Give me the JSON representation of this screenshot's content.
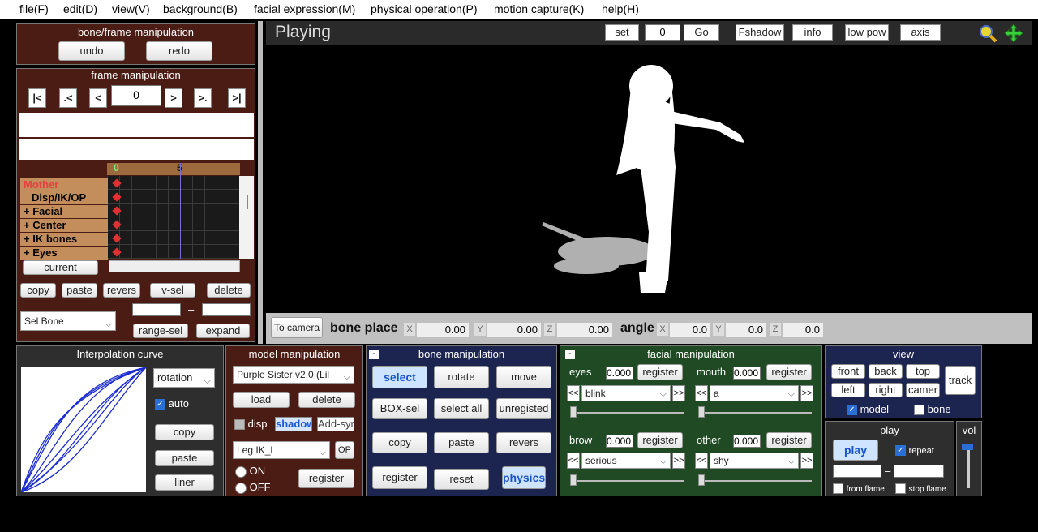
{
  "menu": [
    "file(F)",
    "edit(D)",
    "view(V)",
    "background(B)",
    "facial expression(M)",
    "physical operation(P)",
    "motion capture(K)",
    "help(H)"
  ],
  "bone_frame": {
    "title": "bone/frame manipulation",
    "undo": "undo",
    "redo": "redo"
  },
  "frame": {
    "title": "frame manipulation",
    "nav": [
      "|<",
      ".<",
      "<",
      ">",
      ">.",
      ">|"
    ],
    "value": "0",
    "ruler": [
      "0",
      "5"
    ],
    "tracks": [
      "Mother",
      "Disp/IK/OP",
      "+ Facial",
      "+ Center",
      "+ IK bones",
      "+ Eyes"
    ],
    "current": "current",
    "copy": "copy",
    "paste": "paste",
    "revers": "revers",
    "vsel": "v-sel",
    "delete": "delete",
    "sel_bone": "Sel Bone",
    "dash": "–",
    "range_sel": "range-sel",
    "expand": "expand"
  },
  "viewport": {
    "title": "Playing",
    "set": "set",
    "frame_value": "0",
    "go": "Go",
    "fshadow": "Fshadow",
    "info": "info",
    "lowpow": "low pow",
    "axis": "axis",
    "to_camera": "To camera",
    "bone_place": "bone place",
    "angle": "angle",
    "x": "X",
    "y": "Y",
    "z": "Z",
    "place_x": "0.00",
    "place_y": "0.00",
    "place_z": "0.00",
    "angle_x": "0.0",
    "angle_y": "0.0",
    "angle_z": "0.0"
  },
  "interp": {
    "title": "Interpolation curve",
    "type": "rotation",
    "auto": "auto",
    "copy": "copy",
    "paste": "paste",
    "liner": "liner"
  },
  "model": {
    "title": "model manipulation",
    "model_name": "Purple Sister v2.0 (Lil",
    "load": "load",
    "delete": "delete",
    "disp": "disp",
    "shadow": "shadow",
    "addsyn": "Add-syn",
    "bone": "Leg IK_L",
    "op": "OP",
    "on": "ON",
    "off": "OFF",
    "register": "register"
  },
  "bone": {
    "title": "bone manipulation",
    "select": "select",
    "rotate": "rotate",
    "move": "move",
    "boxsel": "BOX-sel",
    "selectall": "select all",
    "unregisted": "unregisted",
    "copy": "copy",
    "paste": "paste",
    "revers": "revers",
    "register": "register",
    "reset": "reset",
    "physics": "physics"
  },
  "facial": {
    "title": "facial manipulation",
    "eyes": "eyes",
    "mouth": "mouth",
    "brow": "brow",
    "other": "other",
    "val": "0.000",
    "register": "register",
    "eyes_sel": "blink",
    "mouth_sel": "a",
    "brow_sel": "serious",
    "other_sel": "shy",
    "prev": "<<",
    "next": ">>"
  },
  "view": {
    "title": "view",
    "front": "front",
    "back": "back",
    "top": "top",
    "left": "left",
    "right": "right",
    "camer": "camer",
    "track": "track",
    "model": "model",
    "bone": "bone"
  },
  "play": {
    "title": "play",
    "play": "play",
    "repeat": "repeat",
    "dash": "–",
    "from": "from flame",
    "stop": "stop flame"
  },
  "vol": {
    "title": "vol"
  },
  "colors": {
    "accent": "#2a6fd6",
    "panel_brown": "#4a1c14",
    "panel_green": "#1f4a23",
    "panel_navy": "#1c2450"
  }
}
